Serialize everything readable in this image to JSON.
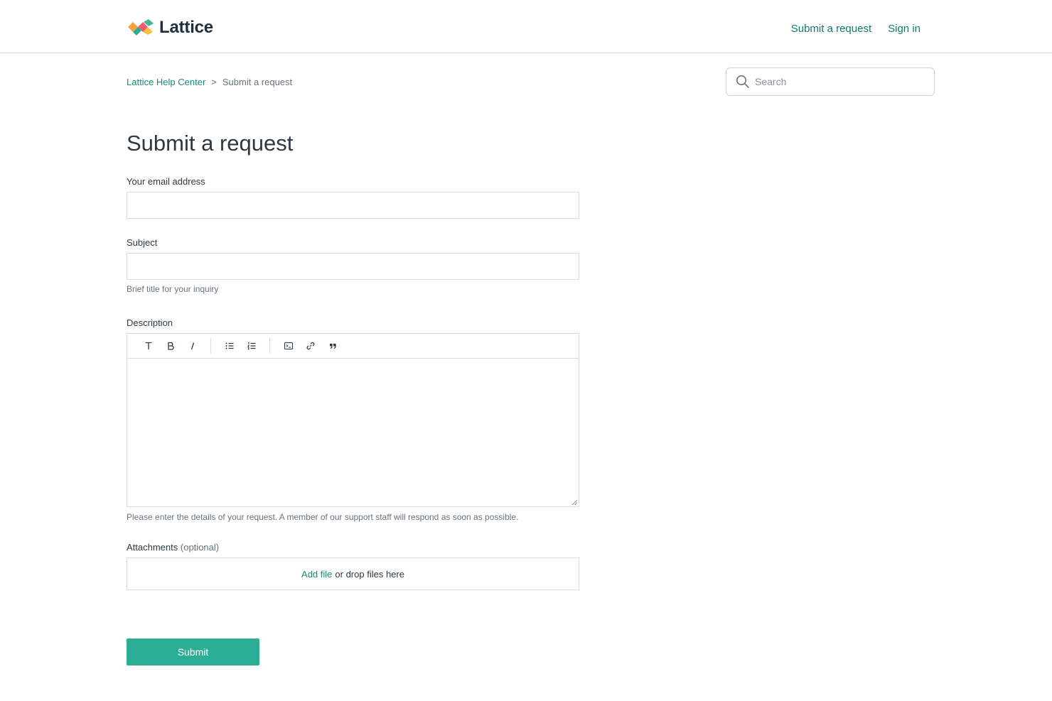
{
  "brand": {
    "name": "Lattice"
  },
  "header": {
    "nav": [
      {
        "label": "Submit a request"
      },
      {
        "label": "Sign in"
      }
    ]
  },
  "breadcrumb": {
    "items": [
      {
        "label": "Lattice Help Center"
      },
      {
        "label": "Submit a request"
      }
    ],
    "separator": ">"
  },
  "search": {
    "placeholder": "Search",
    "icon": "search-icon"
  },
  "page": {
    "title": "Submit a request"
  },
  "form": {
    "email": {
      "label": "Your email address",
      "value": ""
    },
    "subject": {
      "label": "Subject",
      "value": "",
      "hint": "Brief title for your inquiry"
    },
    "description": {
      "label": "Description",
      "hint": "Please enter the details of your request. A member of our support staff will respond as soon as possible.",
      "toolbar": [
        {
          "name": "text-style-icon",
          "glyph": "T"
        },
        {
          "name": "bold-icon",
          "glyph": "B"
        },
        {
          "name": "italic-icon",
          "glyph": "I"
        },
        {
          "name": "bulleted-list-icon"
        },
        {
          "name": "numbered-list-icon"
        },
        {
          "name": "code-block-icon"
        },
        {
          "name": "link-icon"
        },
        {
          "name": "quote-icon"
        }
      ]
    },
    "attachments": {
      "label": "Attachments",
      "optional": "(optional)",
      "add_file": "Add file",
      "drop_text": "or drop files here"
    },
    "submit_label": "Submit"
  },
  "colors": {
    "accent": "#178b76",
    "button": "#2bae94",
    "text": "#2f3941",
    "muted": "#68737d",
    "border": "#d8dcde"
  }
}
